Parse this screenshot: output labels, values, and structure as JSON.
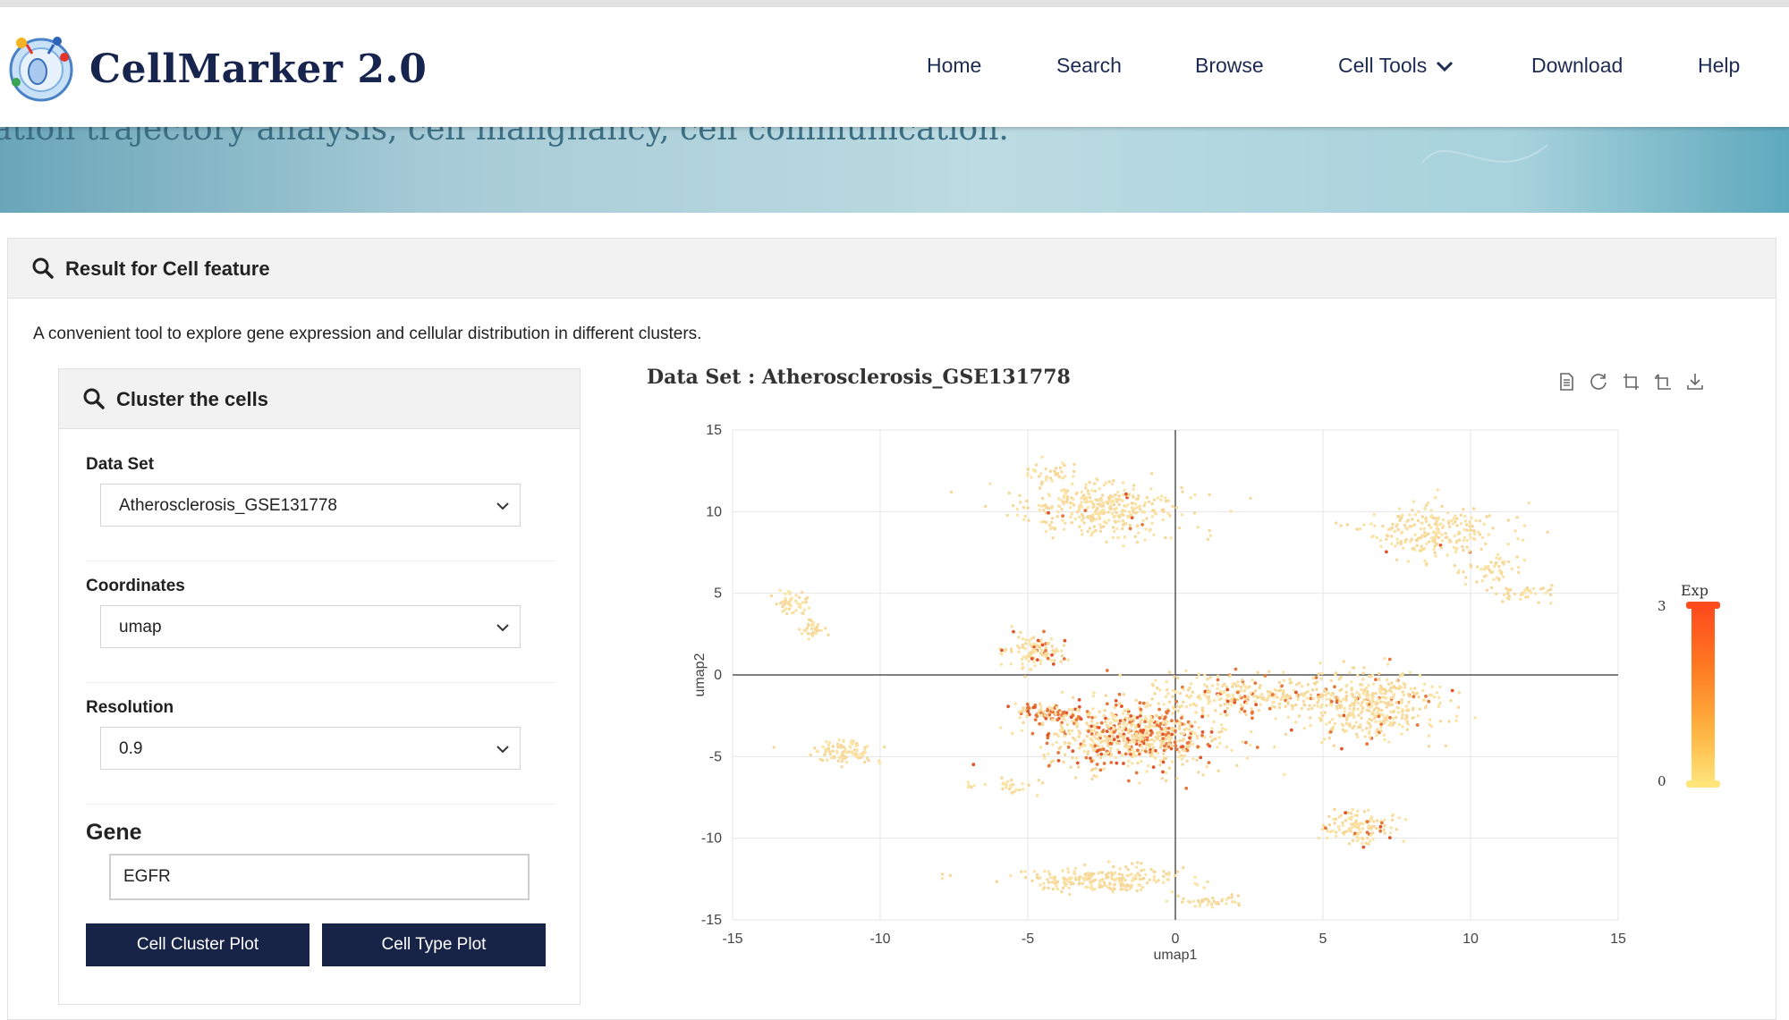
{
  "brand": {
    "name": "CellMarker 2.0"
  },
  "nav": {
    "items": [
      {
        "label": "Home"
      },
      {
        "label": "Search"
      },
      {
        "label": "Browse"
      },
      {
        "label": "Cell Tools"
      },
      {
        "label": "Download"
      },
      {
        "label": "Help"
      }
    ]
  },
  "banner": {
    "text": "ation trajectory analysis, cell malignancy, cell communication."
  },
  "result": {
    "title": "Result for Cell feature",
    "description": "A convenient tool to explore gene expression and cellular distribution in different clusters."
  },
  "form": {
    "title": "Cluster the cells",
    "dataset_label": "Data Set",
    "dataset_value": "Atherosclerosis_GSE131778",
    "coordinates_label": "Coordinates",
    "coordinates_value": "umap",
    "resolution_label": "Resolution",
    "resolution_value": "0.9",
    "gene_label": "Gene",
    "gene_value": "EGFR",
    "cluster_button": "Cell Cluster Plot",
    "type_button": "Cell Type Plot"
  },
  "chart_header": {
    "title": "Data Set : Atherosclerosis_GSE131778"
  },
  "toolbar_icons": [
    "data-view-icon",
    "restore-icon",
    "zoom-icon",
    "zoom-reset-icon",
    "download-icon"
  ],
  "colors": {
    "navy": "#172447",
    "point": "#fbe3a6",
    "point_hot": "#e8763a"
  },
  "chart_data": {
    "type": "scatter",
    "xlabel": "umap1",
    "ylabel": "umap2",
    "xlim": [
      -15,
      15
    ],
    "ylim": [
      -15,
      15
    ],
    "xticks": [
      -15,
      -10,
      -5,
      0,
      5,
      10,
      15
    ],
    "yticks": [
      -15,
      -10,
      -5,
      0,
      5,
      10,
      15
    ],
    "grid": true,
    "legend": {
      "title": "Exp",
      "max": "3",
      "min": "0",
      "placement": "right"
    },
    "clusters": [
      {
        "cx": -2.4,
        "cy": 10.2,
        "rx": 2.8,
        "ry": 1.6,
        "n": 360,
        "hot": 0.02
      },
      {
        "cx": -4.2,
        "cy": 12.3,
        "rx": 0.8,
        "ry": 1.0,
        "n": 40,
        "hot": 0.0
      },
      {
        "cx": 8.6,
        "cy": 8.8,
        "rx": 2.4,
        "ry": 1.7,
        "n": 240,
        "hot": 0.02
      },
      {
        "cx": 10.8,
        "cy": 6.5,
        "rx": 1.0,
        "ry": 0.8,
        "n": 50,
        "hot": 0.0
      },
      {
        "cx": 11.6,
        "cy": 5.0,
        "rx": 1.2,
        "ry": 0.5,
        "n": 40,
        "hot": 0.0
      },
      {
        "cx": -13.0,
        "cy": 4.3,
        "rx": 0.6,
        "ry": 0.9,
        "n": 50,
        "hot": 0.0
      },
      {
        "cx": -12.3,
        "cy": 2.8,
        "rx": 0.4,
        "ry": 0.7,
        "n": 30,
        "hot": 0.0
      },
      {
        "cx": -4.8,
        "cy": 1.4,
        "rx": 1.1,
        "ry": 1.0,
        "n": 110,
        "hot": 0.15
      },
      {
        "cx": -1.4,
        "cy": -3.7,
        "rx": 3.2,
        "ry": 2.1,
        "n": 700,
        "hot": 0.28
      },
      {
        "cx": -4.3,
        "cy": -2.3,
        "rx": 1.2,
        "ry": 0.5,
        "n": 80,
        "hot": 0.5
      },
      {
        "cx": 2.5,
        "cy": -1.2,
        "rx": 3.0,
        "ry": 1.2,
        "n": 260,
        "hot": 0.1
      },
      {
        "cx": 6.5,
        "cy": -1.8,
        "rx": 2.5,
        "ry": 2.0,
        "n": 420,
        "hot": 0.08
      },
      {
        "cx": -11.2,
        "cy": -4.7,
        "rx": 1.0,
        "ry": 0.7,
        "n": 90,
        "hot": 0.0
      },
      {
        "cx": -5.8,
        "cy": -6.8,
        "rx": 1.2,
        "ry": 0.4,
        "n": 30,
        "hot": 0.0
      },
      {
        "cx": 6.3,
        "cy": -9.3,
        "rx": 1.3,
        "ry": 1.0,
        "n": 120,
        "hot": 0.08
      },
      {
        "cx": -2.6,
        "cy": -12.5,
        "rx": 2.6,
        "ry": 0.8,
        "n": 220,
        "hot": 0.01
      },
      {
        "cx": 1.3,
        "cy": -13.9,
        "rx": 1.2,
        "ry": 0.3,
        "n": 40,
        "hot": 0.0
      },
      {
        "cx": -7.8,
        "cy": -12.3,
        "rx": 0.2,
        "ry": 0.2,
        "n": 3,
        "hot": 0.0
      }
    ]
  }
}
